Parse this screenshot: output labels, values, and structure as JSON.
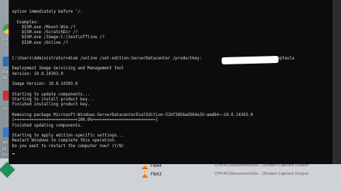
{
  "desktop": {
    "labels": [
      "Go",
      "Ch",
      "Ice",
      "Sp",
      "Scr",
      "WC",
      "pl",
      "Scr"
    ]
  },
  "console": {
    "lines": [
      "option immediately before '/.",
      "",
      "  Examples:",
      "    DISM.exe /Mount-Wim /?",
      "    DISM.exe /ScratchDir /?",
      "    DISM.exe /Image:C:\\test\\offline /?",
      "    DISM.exe /Online /?",
      "",
      "",
      "C:\\Users\\Administrator>dism /online /set-edition:ServerDatacenter /productkey:                           /accepteula",
      "",
      "Deployment Image Servicing and Management tool",
      "Version: 10.0.14393.0",
      "",
      "Image Version: 10.0.14393.0",
      "",
      "Starting to update components...",
      "Starting to install product key...",
      "Finished installing product key.",
      "",
      "Removing package Microsoft-Windows-ServerDatacenterEvalEdition~31bf3856ad364e35~amd64~~10.0.14393.0",
      "[==========================100.0%==========================]",
      "Finished updating components.",
      "",
      "Starting to apply edition-specific settings...",
      "Restart Windows to complete this operation.",
      "Do you want to restart the computer now? (Y/N)"
    ]
  },
  "taskbar": {
    "items": [
      {
        "name": "FBA4",
        "path": "\\\\TH-PC\\Documents\\Sc...\\Screen Capture Output"
      },
      {
        "name": "FBA3",
        "path": "\\\\TH-PC\\Documents\\Sc...\\Screen Capture Output"
      }
    ]
  },
  "colors": {
    "console_bg": "#0c0c0c",
    "console_fg": "#d9d9d9",
    "desktop_bg": "#b9bcc0"
  }
}
